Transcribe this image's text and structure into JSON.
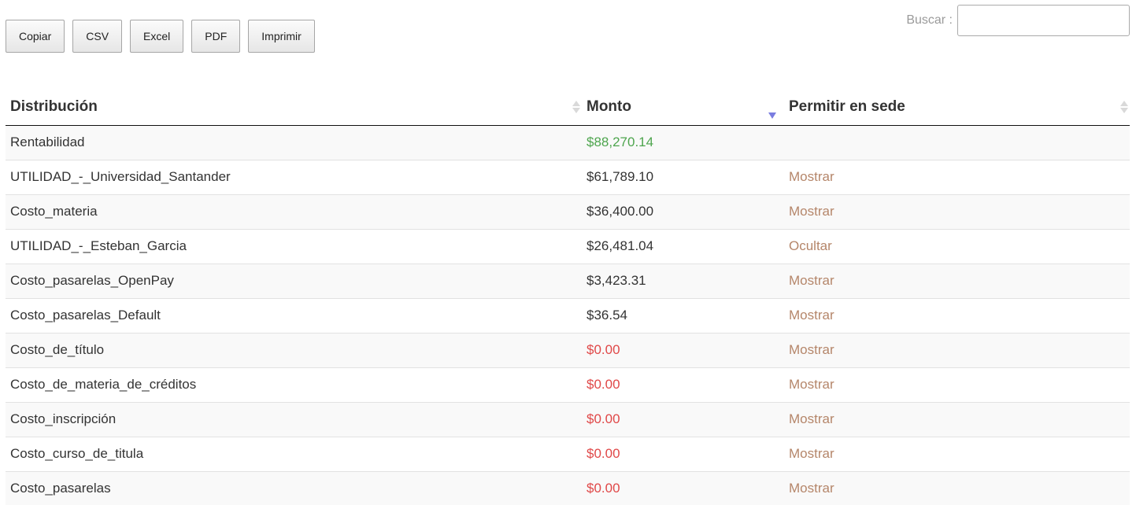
{
  "toolbar": {
    "buttons": [
      "Copiar",
      "CSV",
      "Excel",
      "PDF",
      "Imprimir"
    ]
  },
  "search": {
    "label": "Buscar :",
    "value": ""
  },
  "table": {
    "headers": [
      "Distribución",
      "Monto",
      "Permitir en sede"
    ],
    "sorted_column": "Monto",
    "sort_direction": "desc",
    "rows": [
      {
        "name": "Rentabilidad",
        "amount": "$88,270.14",
        "amount_status": "positive",
        "action": ""
      },
      {
        "name": "UTILIDAD_-_Universidad_Santander",
        "amount": "$61,789.10",
        "amount_status": "normal",
        "action": "Mostrar"
      },
      {
        "name": "Costo_materia",
        "amount": "$36,400.00",
        "amount_status": "normal",
        "action": "Mostrar"
      },
      {
        "name": "UTILIDAD_-_Esteban_Garcia",
        "amount": "$26,481.04",
        "amount_status": "normal",
        "action": "Ocultar"
      },
      {
        "name": "Costo_pasarelas_OpenPay",
        "amount": "$3,423.31",
        "amount_status": "normal",
        "action": "Mostrar"
      },
      {
        "name": "Costo_pasarelas_Default",
        "amount": "$36.54",
        "amount_status": "normal",
        "action": "Mostrar"
      },
      {
        "name": "Costo_de_título",
        "amount": "$0.00",
        "amount_status": "zero",
        "action": "Mostrar"
      },
      {
        "name": "Costo_de_materia_de_créditos",
        "amount": "$0.00",
        "amount_status": "zero",
        "action": "Mostrar"
      },
      {
        "name": "Costo_inscripción",
        "amount": "$0.00",
        "amount_status": "zero",
        "action": "Mostrar"
      },
      {
        "name": "Costo_curso_de_titula",
        "amount": "$0.00",
        "amount_status": "zero",
        "action": "Mostrar"
      },
      {
        "name": "Costo_pasarelas",
        "amount": "$0.00",
        "amount_status": "zero",
        "action": "Mostrar"
      }
    ]
  },
  "colors": {
    "positive_amount": "#4ea54e",
    "zero_amount": "#e04848",
    "action_link": "#b5866a",
    "sort_active": "#7a7de0"
  }
}
